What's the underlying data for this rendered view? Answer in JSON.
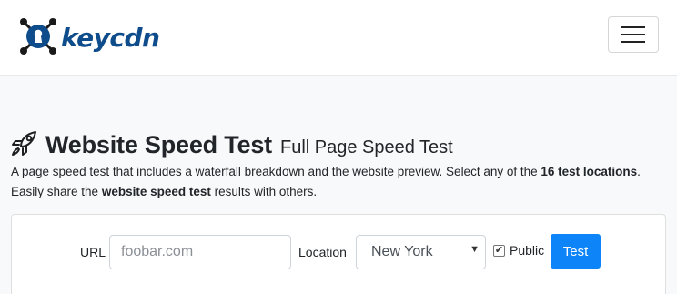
{
  "nav": {
    "brand": "keycdn",
    "brand_color": "#0f4c8b",
    "brand_icon": "keyhole-gear-logo-icon",
    "menu_icon": "hamburger-menu-icon"
  },
  "header": {
    "icon": "rocket-icon",
    "title": "Website Speed Test",
    "subtitle": "Full Page Speed Test"
  },
  "description": {
    "part1": "A page speed test that includes a waterfall breakdown and the website preview. Select any of the ",
    "bold1": "16 test locations",
    "part2": ". Easily share the ",
    "bold2": "website speed test",
    "part3": " results with others."
  },
  "form": {
    "url_label": "URL",
    "url_placeholder": "foobar.com",
    "url_value": "",
    "location_label": "Location",
    "location_selected": "New York",
    "location_caret_icon": "chevron-down-icon",
    "public_label": "Public",
    "public_checked": true,
    "test_label": "Test",
    "test_color": "#0d84f7"
  }
}
